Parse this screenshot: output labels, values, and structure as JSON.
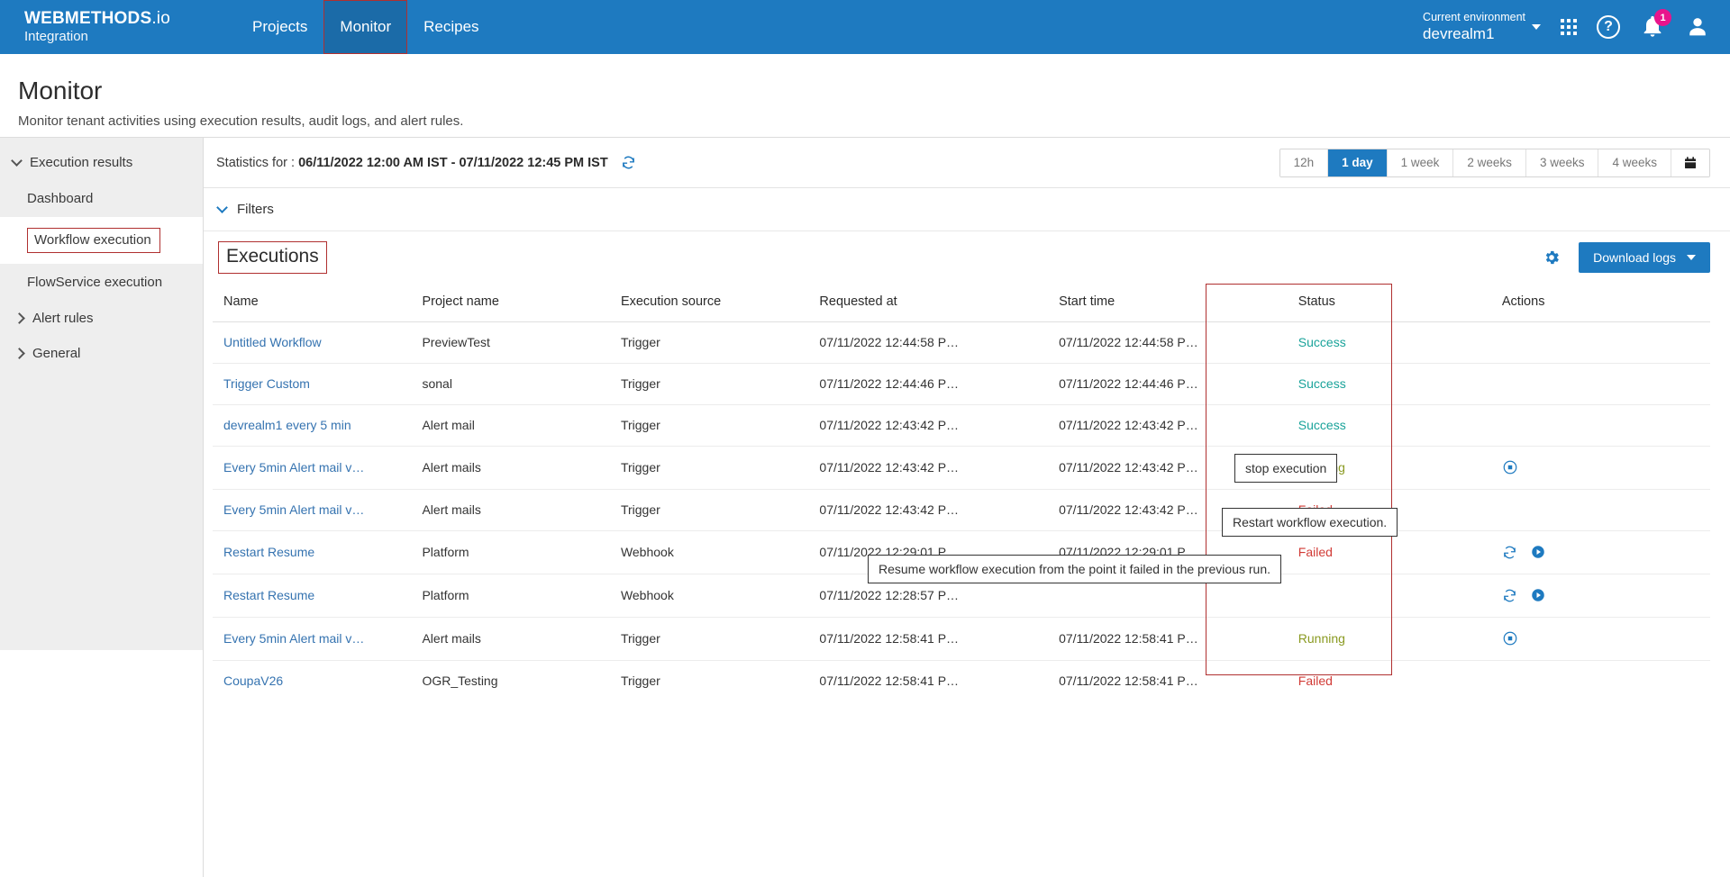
{
  "topbar": {
    "brand": {
      "bold": "WEBMETHODS",
      "suffix": ".io",
      "sub": "Integration"
    },
    "nav": [
      {
        "label": "Projects",
        "active": false
      },
      {
        "label": "Monitor",
        "active": true
      },
      {
        "label": "Recipes",
        "active": false
      }
    ],
    "environment": {
      "label": "Current environment",
      "value": "devrealm1"
    },
    "icons": {
      "apps": "apps-grid-icon",
      "help": "help-icon",
      "notifications": "bell-icon",
      "profile": "user-avatar-icon"
    },
    "notification_count": "1"
  },
  "page": {
    "title": "Monitor",
    "subtitle": "Monitor tenant activities using execution results, audit logs, and alert rules."
  },
  "sidebar": {
    "groups": [
      {
        "label": "Execution results",
        "expanded": true
      },
      {
        "label": "Alert rules",
        "expanded": false
      },
      {
        "label": "General",
        "expanded": false
      }
    ],
    "items": [
      {
        "label": "Dashboard",
        "current": false
      },
      {
        "label": "Workflow execution",
        "current": true
      },
      {
        "label": "FlowService execution",
        "current": false
      }
    ]
  },
  "stats": {
    "prefix": "Statistics for : ",
    "range": "06/11/2022 12:00 AM IST - 07/11/2022 12:45 PM IST",
    "refresh_icon": "refresh-icon"
  },
  "ranges": {
    "options": [
      "12h",
      "1 day",
      "1 week",
      "2 weeks",
      "3 weeks",
      "4 weeks"
    ],
    "selected": "1 day",
    "calendar_icon": "calendar-icon"
  },
  "filters": {
    "label": "Filters",
    "expanded": true
  },
  "toolbar": {
    "title": "Executions",
    "settings_icon": "gear-icon",
    "download_label": "Download logs"
  },
  "table": {
    "columns": [
      "Name",
      "Project name",
      "Execution source",
      "Requested at",
      "Start time",
      "Status",
      "Actions"
    ],
    "rows": [
      {
        "name": "Untitled Workflow",
        "project": "PreviewTest",
        "source": "Trigger",
        "requested": "07/11/2022 12:44:58 P…",
        "start": "07/11/2022 12:44:58 P…",
        "status": "Success",
        "status_kind": "success",
        "actions": []
      },
      {
        "name": "Trigger Custom",
        "project": "sonal",
        "source": "Trigger",
        "requested": "07/11/2022 12:44:46 P…",
        "start": "07/11/2022 12:44:46 P…",
        "status": "Success",
        "status_kind": "success",
        "actions": []
      },
      {
        "name": "devrealm1 every 5 min",
        "project": "Alert mail",
        "source": "Trigger",
        "requested": "07/11/2022 12:43:42 P…",
        "start": "07/11/2022 12:43:42 P…",
        "status": "Success",
        "status_kind": "success",
        "actions": []
      },
      {
        "name": "Every 5min Alert mail v…",
        "project": "Alert mails",
        "source": "Trigger",
        "requested": "07/11/2022 12:43:42 P…",
        "start": "07/11/2022 12:43:42 P…",
        "status": "Running",
        "status_kind": "running",
        "actions": [
          "stop"
        ]
      },
      {
        "name": "Every 5min Alert mail v…",
        "project": "Alert mails",
        "source": "Trigger",
        "requested": "07/11/2022 12:43:42 P…",
        "start": "07/11/2022 12:43:42 P…",
        "status": "Failed",
        "status_kind": "failed",
        "actions": []
      },
      {
        "name": "Restart Resume",
        "project": "Platform",
        "source": "Webhook",
        "requested": "07/11/2022 12:29:01 P…",
        "start": "07/11/2022 12:29:01 P…",
        "status": "Failed",
        "status_kind": "failed",
        "actions": [
          "restart",
          "resume"
        ]
      },
      {
        "name": "Restart Resume",
        "project": "Platform",
        "source": "Webhook",
        "requested": "07/11/2022 12:28:57 P…",
        "start": "",
        "status": "",
        "status_kind": "none",
        "actions": [
          "restart",
          "resume"
        ]
      },
      {
        "name": "Every 5min Alert mail v…",
        "project": "Alert mails",
        "source": "Trigger",
        "requested": "07/11/2022 12:58:41 P…",
        "start": "07/11/2022 12:58:41 P…",
        "status": "Running",
        "status_kind": "running",
        "actions": [
          "stop"
        ]
      },
      {
        "name": "CoupaV26",
        "project": "OGR_Testing",
        "source": "Trigger",
        "requested": "07/11/2022 12:58:41 P…",
        "start": "07/11/2022 12:58:41 P…",
        "status": "Failed",
        "status_kind": "failed",
        "actions": []
      }
    ]
  },
  "tooltips": {
    "stop": "stop execution",
    "restart": "Restart workflow execution.",
    "resume": "Resume workflow execution from the point it failed in the previous run."
  },
  "colors": {
    "brand_blue": "#1e7ac0",
    "success": "#1aa39a",
    "running": "#8a9a21",
    "failed": "#d13b36",
    "annotation_red": "#b03030",
    "badge_pink": "#e8148c"
  }
}
